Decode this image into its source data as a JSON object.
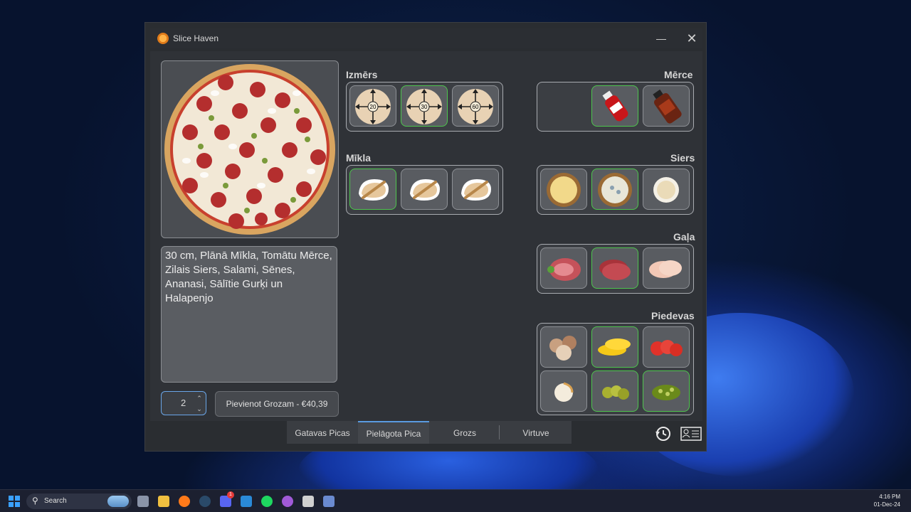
{
  "window": {
    "title": "Slice Haven"
  },
  "sections": {
    "size": {
      "label": "Izmērs",
      "options": [
        "20",
        "30",
        "60"
      ],
      "selected_index": 1
    },
    "dough": {
      "label": "Mīkla",
      "selected_index": 0
    },
    "sauce": {
      "label": "Mērce",
      "selected": [
        0
      ]
    },
    "cheese": {
      "label": "Siers",
      "selected": [
        1
      ]
    },
    "meat": {
      "label": "Gaļa",
      "selected": [
        1
      ]
    },
    "toppings": {
      "label": "Piedevas",
      "selected": [
        1,
        4,
        5
      ]
    }
  },
  "description": "30 cm, Plānā Mīkla, Tomātu Mērce, Zilais Siers, Salami, Sēnes, Ananasi, Sālītie Gurķi un Halapenjo",
  "quantity": {
    "value": "2"
  },
  "add_button": {
    "label": "Pievienot Grozam - €40,39"
  },
  "tabs": [
    "Gatavas Picas",
    "Pielāgota Pica",
    "Grozs",
    "Virtuve"
  ],
  "active_tab": 1,
  "taskbar": {
    "search_placeholder": "Search",
    "time": "4:16 PM",
    "date": "01-Dec-24",
    "discord_badge": "1"
  },
  "colors": {
    "selected_border": "#4ec44e",
    "active_tab_accent": "#5a9be0"
  }
}
